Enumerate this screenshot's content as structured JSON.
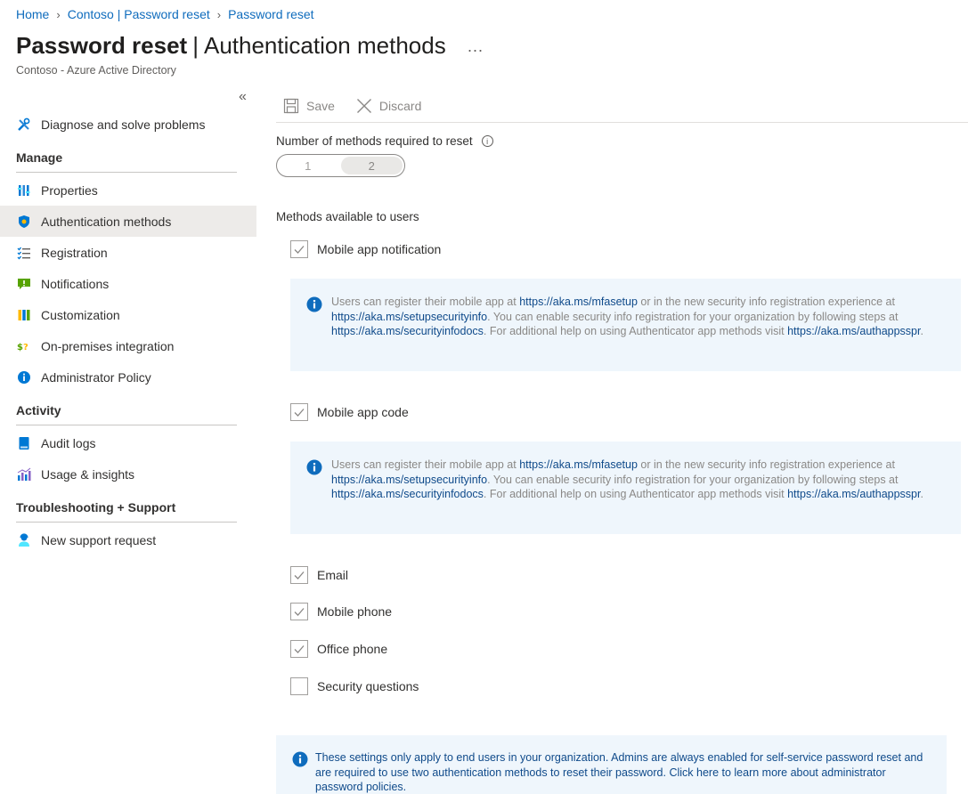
{
  "breadcrumb": [
    "Home",
    "Contoso | Password reset",
    "Password reset"
  ],
  "header": {
    "title": "Password reset",
    "title_sub": "Authentication methods",
    "more": "...",
    "subtitle": "Contoso - Azure Active Directory"
  },
  "sidebar": {
    "collapse": "«",
    "diagnose": "Diagnose and solve problems",
    "sections": [
      {
        "heading": "Manage",
        "items": [
          "Properties",
          "Authentication methods",
          "Registration",
          "Notifications",
          "Customization",
          "On-premises integration",
          "Administrator Policy"
        ]
      },
      {
        "heading": "Activity",
        "items": [
          "Audit logs",
          "Usage & insights"
        ]
      },
      {
        "heading": "Troubleshooting + Support",
        "items": [
          "New support request"
        ]
      }
    ],
    "active_item": "Authentication methods"
  },
  "toolbar": {
    "save_label": "Save",
    "discard_label": "Discard"
  },
  "methods_required": {
    "label": "Number of methods required to reset",
    "options": [
      "1",
      "2"
    ],
    "selected": "2"
  },
  "methods_available_label": "Methods available to users",
  "methods": [
    {
      "label": "Mobile app notification",
      "checked": true
    },
    {
      "label": "Mobile app code",
      "checked": true
    },
    {
      "label": "Email",
      "checked": true
    },
    {
      "label": "Mobile phone",
      "checked": true
    },
    {
      "label": "Office phone",
      "checked": true
    },
    {
      "label": "Security questions",
      "checked": false
    }
  ],
  "info": {
    "t1": "Users can register their mobile app at ",
    "l1": "https://aka.ms/mfasetup",
    "t2": " or in the new security info registration experience at ",
    "l2": "https://aka.ms/setupsecurityinfo",
    "t3": ". You can enable security info registration for your organization by following steps at ",
    "l3": "https://aka.ms/securityinfodocs",
    "t4": ". For additional help on using Authenticator app methods visit ",
    "l4": "https://aka.ms/authappsspr",
    "t5": "."
  },
  "footer_note": "These settings only apply to end users in your organization. Admins are always enabled for self-service password reset and are required to use two authentication methods to reset their password. Click here to learn more about administrator password policies.",
  "colors": {
    "accent": "#0078d4",
    "info_bg": "#eff6fc",
    "active_bg": "#edebe9"
  }
}
